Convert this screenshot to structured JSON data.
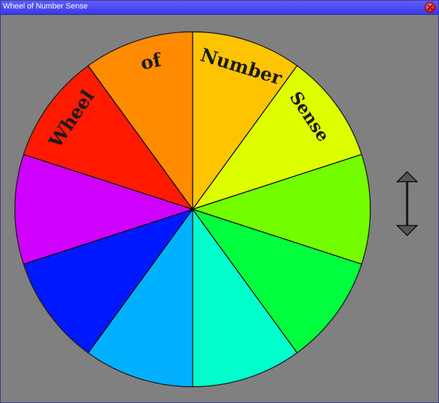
{
  "window": {
    "title": "Wheel of Number Sense"
  },
  "wheel": {
    "segments": [
      {
        "color": "#ffc400",
        "label": ""
      },
      {
        "color": "#ddff00",
        "label": ""
      },
      {
        "color": "#73ff00",
        "label": ""
      },
      {
        "color": "#00ff3c",
        "label": ""
      },
      {
        "color": "#00ffcc",
        "label": ""
      },
      {
        "color": "#00b0ff",
        "label": ""
      },
      {
        "color": "#0018ff",
        "label": ""
      },
      {
        "color": "#d000ff",
        "label": ""
      },
      {
        "color": "#ff1a00",
        "label": ""
      },
      {
        "color": "#ff8c00",
        "label": ""
      }
    ],
    "words": [
      "Number",
      "Sense",
      "Wheel",
      "of"
    ]
  },
  "icons": {
    "close": "close-icon",
    "spin_arrow": "double-arrow-vertical-icon"
  }
}
